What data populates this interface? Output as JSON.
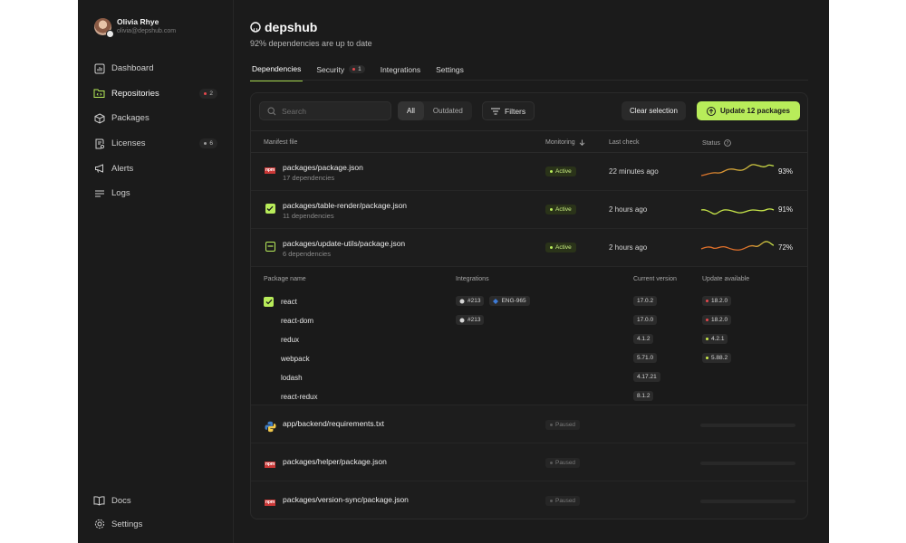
{
  "profile": {
    "name": "Olivia Rhye",
    "email": "olivia@depshub.com"
  },
  "sidebar": {
    "items": [
      {
        "label": "Dashboard",
        "icon": "dashboard-icon"
      },
      {
        "label": "Repositories",
        "icon": "folder-code-icon",
        "badge": "2",
        "badge_color": "#e5484d"
      },
      {
        "label": "Packages",
        "icon": "package-icon"
      },
      {
        "label": "Licenses",
        "icon": "license-icon",
        "badge": "6",
        "badge_color": "#9a9a9a"
      },
      {
        "label": "Alerts",
        "icon": "megaphone-icon"
      },
      {
        "label": "Logs",
        "icon": "logs-icon"
      }
    ],
    "bottom": [
      {
        "label": "Docs",
        "icon": "book-icon"
      },
      {
        "label": "Settings",
        "icon": "gear-icon"
      }
    ]
  },
  "header": {
    "title": "depshub",
    "subtitle": "92% dependencies are up to date"
  },
  "tabs": [
    {
      "label": "Dependencies",
      "active": true
    },
    {
      "label": "Security",
      "badge": "1"
    },
    {
      "label": "Integrations"
    },
    {
      "label": "Settings"
    }
  ],
  "toolbar": {
    "search_placeholder": "Search",
    "seg_all": "All",
    "seg_outdated": "Outdated",
    "filters": "Filters",
    "clear": "Clear selection",
    "update": "Update 12 packages"
  },
  "columns": {
    "manifest": "Manifest file",
    "monitoring": "Monitoring",
    "last_check": "Last check",
    "status": "Status"
  },
  "rows": [
    {
      "file": "packages/package.json",
      "deps": "17 dependencies",
      "icon": "npm",
      "monitoring": "Active",
      "last_check": "22 minutes ago",
      "status": "93%"
    },
    {
      "file": "packages/table-render/package.json",
      "deps": "11 dependencies",
      "icon": "checkbox-checked",
      "monitoring": "Active",
      "last_check": "2 hours ago",
      "status": "91%"
    },
    {
      "file": "packages/update-utils/package.json",
      "deps": "6 dependencies",
      "icon": "checkbox-indeterminate",
      "monitoring": "Active",
      "last_check": "2 hours ago",
      "status": "72%"
    },
    {
      "file": "app/backend/requirements.txt",
      "icon": "python",
      "monitoring": "Paused"
    },
    {
      "file": "packages/helper/package.json",
      "icon": "npm",
      "monitoring": "Paused"
    },
    {
      "file": "packages/version-sync/package.json",
      "icon": "npm",
      "monitoring": "Paused"
    }
  ],
  "sub_columns": {
    "package": "Package name",
    "integrations": "Integrations",
    "current": "Current version",
    "available": "Update available"
  },
  "packages": [
    {
      "name": "react",
      "checked": true,
      "integrations": [
        "#213",
        "ENG-965"
      ],
      "current": "17.0.2",
      "available": "18.2.0",
      "avail_color": "#e5484d"
    },
    {
      "name": "react-dom",
      "integrations": [
        "#213"
      ],
      "current": "17.0.0",
      "available": "18.2.0",
      "avail_color": "#e5484d"
    },
    {
      "name": "redux",
      "integrations": [],
      "current": "4.1.2",
      "available": "4.2.1",
      "avail_color": "#c9e84a"
    },
    {
      "name": "webpack",
      "integrations": [],
      "current": "5.71.0",
      "available": "5.88.2",
      "avail_color": "#c9e84a"
    },
    {
      "name": "lodash",
      "integrations": [],
      "current": "4.17.21",
      "available": ""
    },
    {
      "name": "react-redux",
      "integrations": [],
      "current": "8.1.2",
      "available": ""
    }
  ],
  "colors": {
    "accent": "#b8ec5a",
    "background": "#1b1b1b",
    "danger": "#e5484d"
  }
}
